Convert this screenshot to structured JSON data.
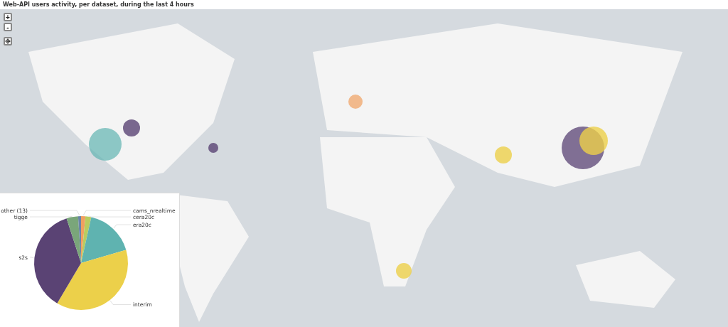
{
  "title": "Web-API users activity, per dataset, during the last 4 hours",
  "map": {
    "kind": "picture",
    "zoom_buttons": [
      "+",
      "-"
    ]
  },
  "pie_panel": {
    "chart_data": {
      "type": "pie",
      "categories": [
        "cams_nrealtime",
        "cera20c",
        "era20c",
        "interim",
        "s2s",
        "tigge",
        "other (13)"
      ],
      "values": [
        1.5,
        2,
        17,
        38,
        36.5,
        4,
        1
      ],
      "colors": [
        "#f0a060",
        "#b8cc60",
        "#5fb3b0",
        "#ecd04a",
        "#5a4374",
        "#7aa67a",
        "#6a85a8"
      ]
    }
  }
}
